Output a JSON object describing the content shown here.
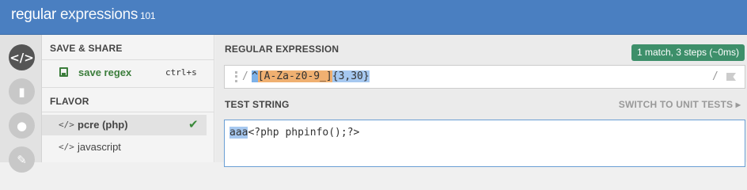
{
  "brand": {
    "primary": "regular",
    "secondary": " expressions",
    "version": " 101"
  },
  "rail": {
    "icons": [
      "code-icon",
      "book-icon",
      "user-icon",
      "wrench-icon"
    ]
  },
  "side": {
    "save_heading": "SAVE & SHARE",
    "save_label": "save regex",
    "save_shortcut": "ctrl+s",
    "flavor_heading": "FLAVOR",
    "flavors": [
      {
        "code": "</>",
        "label": "pcre (php)",
        "selected": true
      },
      {
        "code": "</>",
        "label": "javascript",
        "selected": false
      }
    ]
  },
  "regex": {
    "heading": "REGULAR EXPRESSION",
    "badge": "1 match, 3 steps (~0ms)",
    "open_delim": "/",
    "close_delim": "/",
    "anchor": "^",
    "char_class": "[A-Za-z0-9_]",
    "quantifier": "{3,30}"
  },
  "test": {
    "heading": "TEST STRING",
    "unit_tests": "SWITCH TO UNIT TESTS ▸",
    "match_part": "aaa",
    "rest_part": "<?php phpinfo();?>"
  },
  "colors": {
    "topbar": "#4a7fc1",
    "badge": "#3d8f6a",
    "save_green": "#3b7d3b"
  }
}
